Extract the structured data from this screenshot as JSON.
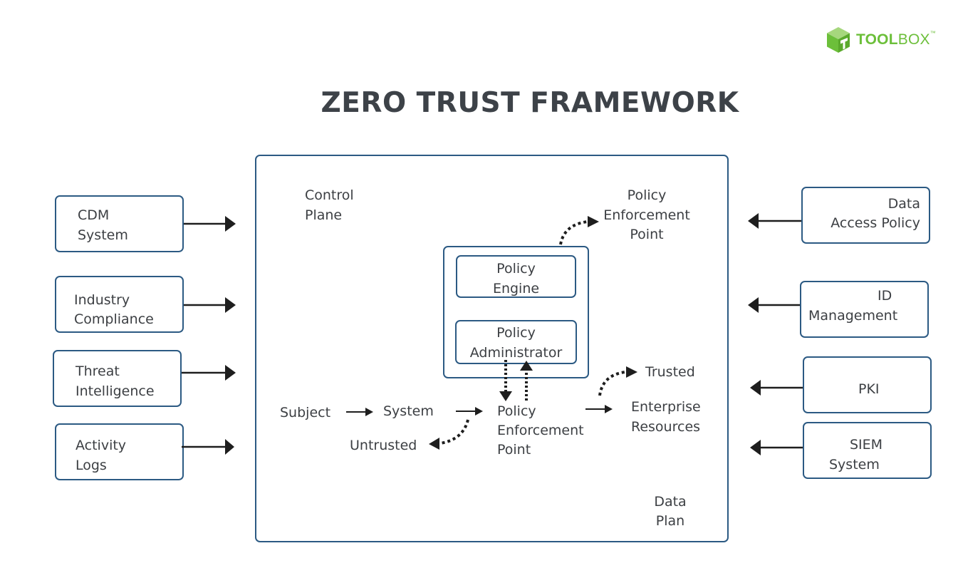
{
  "brand": {
    "logo_icon": "green-cube-icon",
    "name_bold": "TOOL",
    "name_light": "BOX",
    "trademark": "™",
    "color": "#6cbf3a"
  },
  "title": "ZERO TRUST FRAMEWORK",
  "colors": {
    "box_border": "#2c5a83",
    "text": "#3c3f43",
    "arrow": "#1e1e1e"
  },
  "inputs_left": [
    {
      "line1": "CDM",
      "line2": "System"
    },
    {
      "line1": "Industry",
      "line2": "Compliance"
    },
    {
      "line1": "Threat",
      "line2": "Intelligence"
    },
    {
      "line1": "Activity",
      "line2": "Logs"
    }
  ],
  "inputs_right": [
    {
      "line1": "Data",
      "line2": "Access Policy"
    },
    {
      "line1": "ID",
      "line2": "Management"
    },
    {
      "line1": "PKI",
      "line2": ""
    },
    {
      "line1": "SIEM",
      "line2": "System"
    }
  ],
  "main_frame": {
    "control_plane": {
      "line1": "Control",
      "line2": "Plane"
    },
    "data_plane": {
      "line1": "Data",
      "line2": "Plan"
    },
    "pep_top": {
      "line1": "Policy",
      "line2": "Enforcement",
      "line3": "Point"
    },
    "policy_engine": {
      "line1": "Policy",
      "line2": "Engine"
    },
    "policy_administrator": {
      "line1": "Policy",
      "line2": "Administrator"
    },
    "flow": {
      "subject": "Subject",
      "system": "System",
      "untrusted": "Untrusted",
      "pep": {
        "line1": "Policy",
        "line2": "Enforcement",
        "line3": "Point"
      },
      "trusted": "Trusted",
      "enterprise": {
        "line1": "Enterprise",
        "line2": "Resources"
      }
    }
  }
}
